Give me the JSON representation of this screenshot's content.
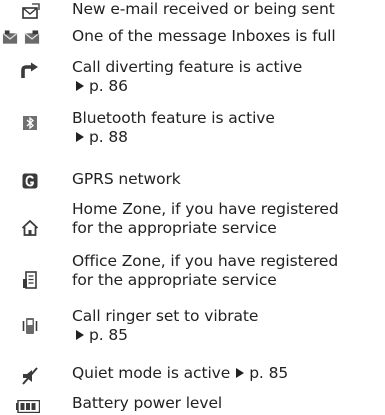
{
  "items": [
    {
      "icon": "envelope-sending-icon",
      "text": "New e-mail received or being sent"
    },
    {
      "icon": "inbox-full-icon",
      "text": "One of the message Inboxes is full"
    },
    {
      "icon": "call-divert-icon",
      "text": "Call diverting feature is active",
      "ref": "p. 86"
    },
    {
      "icon": "bluetooth-icon",
      "text": "Bluetooth feature is active",
      "ref": "p. 88"
    },
    {
      "icon": "gprs-icon",
      "text": "GPRS network"
    },
    {
      "icon": "home-zone-icon",
      "line1": "Home Zone, if you have registered",
      "line2": "for the appropriate service"
    },
    {
      "icon": "office-zone-icon",
      "line1": "Office Zone, if you have registered",
      "line2": "for the appropriate service"
    },
    {
      "icon": "vibrate-icon",
      "text": "Call ringer set to vibrate",
      "ref": "p. 85"
    },
    {
      "icon": "quiet-mode-icon",
      "text": "Quiet mode is active",
      "ref": "p. 85"
    },
    {
      "icon": "battery-icon",
      "text": "Battery power level"
    }
  ],
  "colors": {
    "icon_dark": "#3a3a3a",
    "icon_mid": "#7a7a7a",
    "text": "#222222"
  }
}
